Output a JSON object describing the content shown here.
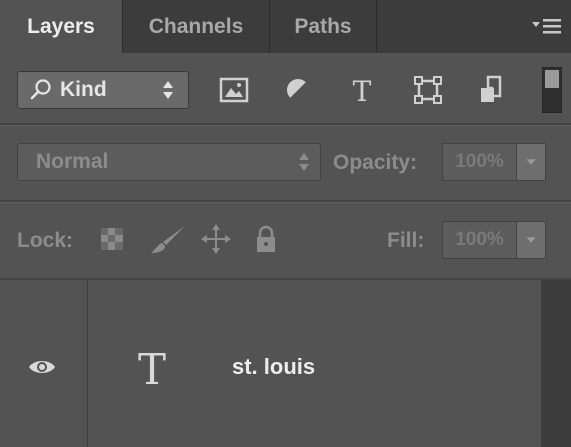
{
  "tabs": [
    {
      "label": "Layers",
      "active": true
    },
    {
      "label": "Channels",
      "active": false
    },
    {
      "label": "Paths",
      "active": false
    }
  ],
  "filter": {
    "kind_label": "Kind",
    "icons": [
      "image-filter-icon",
      "adjustment-filter-icon",
      "type-filter-icon",
      "shape-filter-icon",
      "smart-object-filter-icon"
    ],
    "type_glyph": "T"
  },
  "blend": {
    "mode": "Normal",
    "opacity_label": "Opacity:",
    "opacity_value": "100%"
  },
  "lock": {
    "label": "Lock:",
    "fill_label": "Fill:",
    "fill_value": "100%"
  },
  "layers": [
    {
      "name": "st. louis",
      "type": "text",
      "type_glyph": "T",
      "visible": true
    }
  ],
  "colors": {
    "panel": "#535353",
    "tabbar": "#3c3c3c",
    "text": "#ededed",
    "dim_text": "#8c8c8c"
  }
}
